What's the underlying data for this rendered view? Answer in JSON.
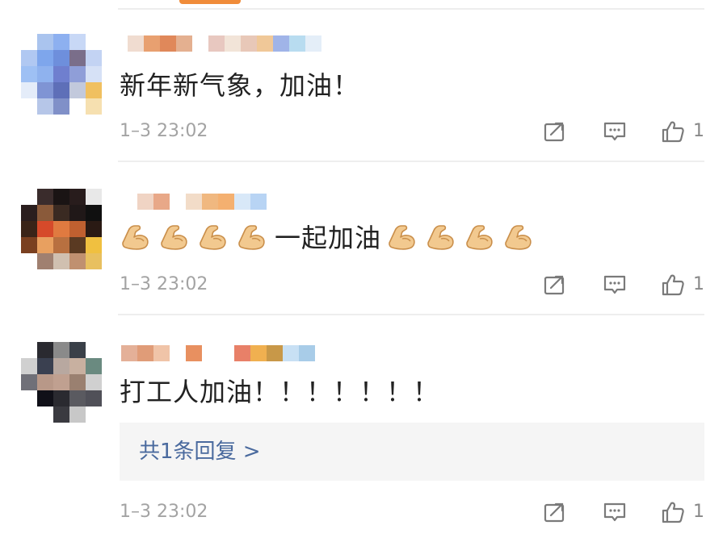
{
  "comments": [
    {
      "text": "新年新气象，加油！",
      "emoji_before": 0,
      "emoji_after": 0,
      "timestamp": "1–3 23:02",
      "likes": "1",
      "avatar_colors": [
        "#ffffff",
        "#aac4ee",
        "#8db0f0",
        "#c8d8f6",
        "#ffffff",
        "#b0c8f2",
        "#7ea6ec",
        "#6e8fdc",
        "#7a6e8a",
        "#c3d3f3",
        "#9ec0f4",
        "#8fb2ee",
        "#6f7fcf",
        "#8f9ed8",
        "#d6e1f6",
        "#e4ecf9",
        "#7f94d4",
        "#5e6fb8",
        "#c2c9dc",
        "#f0c060",
        "#ffffff",
        "#b6c6e8",
        "#8090c8",
        "#ffffff",
        "#f6e0b0"
      ],
      "name_colors": [
        "#f0dcd0",
        "#e8a070",
        "#e0885a",
        "#e4b090",
        "#ffffff",
        "#e8c8c0",
        "#f2e4d8",
        "#e8c8b8",
        "#f0c898",
        "#a0b4e8",
        "#b8dcf0",
        "#e4eef8"
      ]
    },
    {
      "text": "一起加油",
      "emoji_before": 4,
      "emoji_after": 4,
      "timestamp": "1–3 23:02",
      "likes": "1",
      "avatar_colors": [
        "#ffffff",
        "#3a2c2c",
        "#1a1414",
        "#281c1c",
        "#e8e8e8",
        "#2a1e1e",
        "#8a5a3a",
        "#3a2a22",
        "#201818",
        "#101010",
        "#3a2418",
        "#d64a2a",
        "#e07a40",
        "#c06030",
        "#2a1a14",
        "#7a4020",
        "#e8a060",
        "#b87040",
        "#5a3a22",
        "#f0c040",
        "#ffffff",
        "#a08070",
        "#d0c0b0",
        "#c09070",
        "#e8c060"
      ],
      "name_colors": [
        "#ffffff",
        "#f0d4c4",
        "#e8a888",
        "#ffffff",
        "#f2dcc8",
        "#f0b880",
        "#f4b070",
        "#d8e8f8",
        "#b8d4f4"
      ]
    },
    {
      "text": "打工人加油！！！！！！！",
      "emoji_before": 0,
      "emoji_after": 0,
      "timestamp": "1–3 23:02",
      "likes": "1",
      "reply_link": "共1条回复 >",
      "avatar_colors": [
        "#ffffff",
        "#2a2a30",
        "#8a8a8a",
        "#3a4048",
        "#ffffff",
        "#d0d0d0",
        "#3a4050",
        "#b8a8a0",
        "#c8b0a0",
        "#6a8a80",
        "#707078",
        "#b89888",
        "#c0a090",
        "#9a8070",
        "#d0d0d0",
        "#ffffff",
        "#101018",
        "#2a2a30",
        "#5a5a60",
        "#505058",
        "#ffffff",
        "#ffffff",
        "#3a3a40",
        "#c8c8c8",
        "#ffffff"
      ],
      "name_colors": [
        "#e4b098",
        "#e09c78",
        "#f0c4a8",
        "#ffffff",
        "#e89060",
        "#ffffff",
        "#ffffff",
        "#e88068",
        "#f0b050",
        "#c89848",
        "#c8e0f4",
        "#a8cce8"
      ]
    }
  ],
  "icons": {
    "forward": "forward-icon",
    "reply": "comment-icon",
    "like": "thumbs-up-icon",
    "emoji": "flexed-biceps-emoji"
  },
  "colors": {
    "accent_tab": "#f08c3a",
    "timestamp": "#a3a3a3",
    "reply_link": "#4a6a9e"
  }
}
